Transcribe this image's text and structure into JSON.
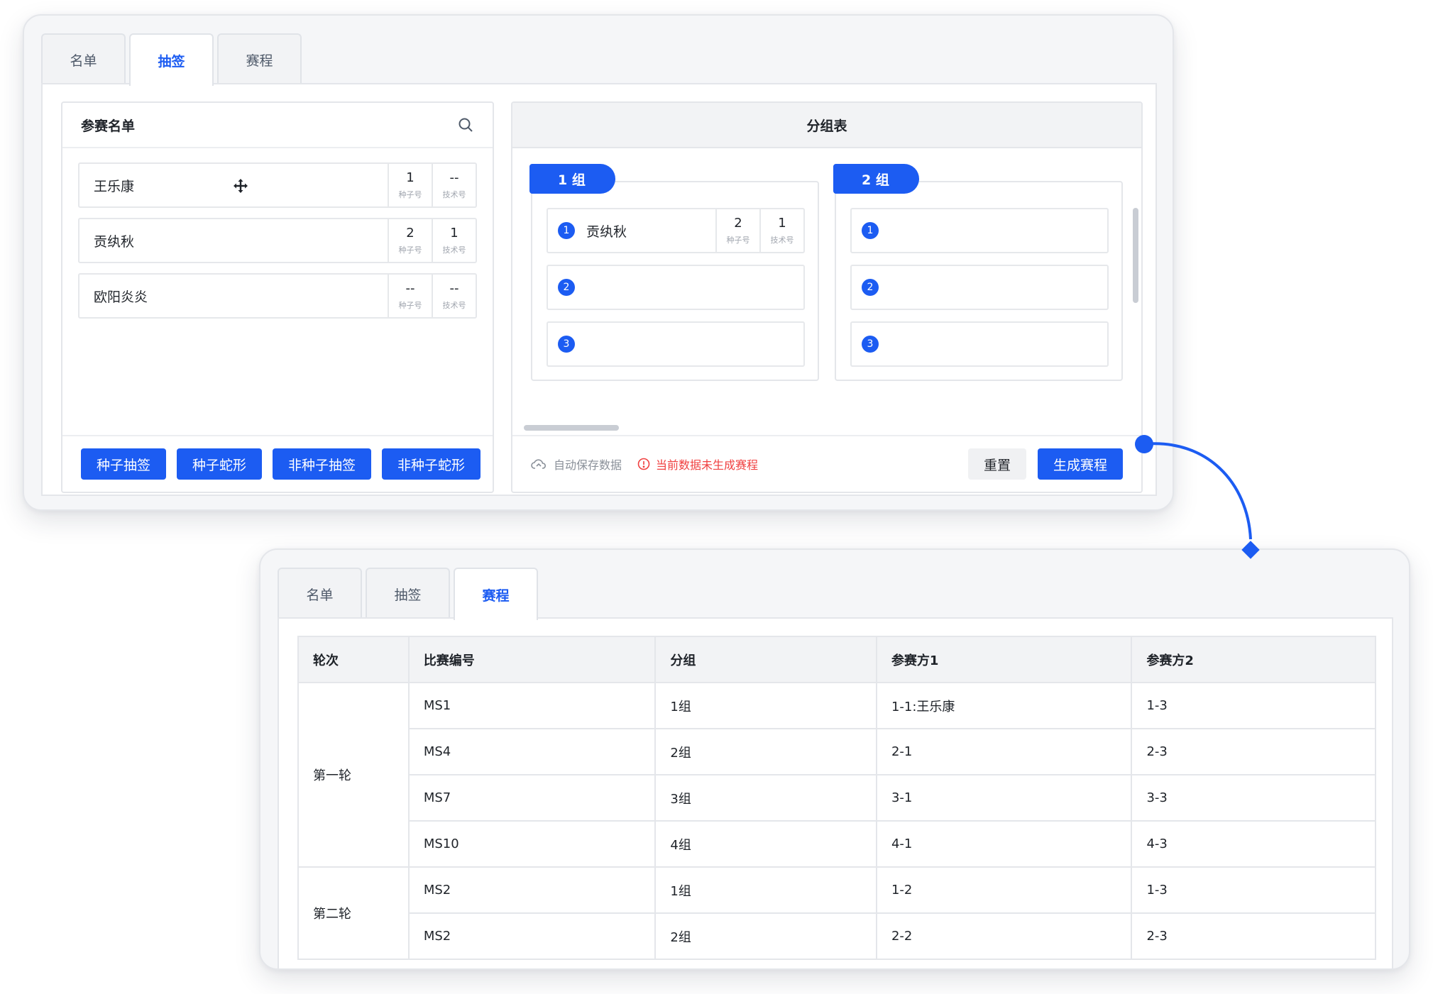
{
  "tabs": [
    "名单",
    "抽签",
    "赛程"
  ],
  "roster": {
    "title": "参赛名单",
    "seed_label": "种子号",
    "tech_label": "技术号",
    "players": [
      {
        "name": "王乐康",
        "seed": "1",
        "tech": "--"
      },
      {
        "name": "贡纨秋",
        "seed": "2",
        "tech": "1"
      },
      {
        "name": "欧阳炎炎",
        "seed": "--",
        "tech": "--"
      }
    ],
    "buttons": [
      "种子抽签",
      "种子蛇形",
      "非种子抽签",
      "非种子蛇形"
    ]
  },
  "groups": {
    "title": "分组表",
    "list": [
      {
        "label": "1 组",
        "slots": [
          {
            "num": "1",
            "name": "贡纨秋",
            "seed": "2",
            "tech": "1"
          },
          {
            "num": "2",
            "name": ""
          },
          {
            "num": "3",
            "name": ""
          }
        ]
      },
      {
        "label": "2 组",
        "slots": [
          {
            "num": "1",
            "name": ""
          },
          {
            "num": "2",
            "name": ""
          },
          {
            "num": "3",
            "name": ""
          }
        ]
      }
    ],
    "autosave": "自动保存数据",
    "warning": "当前数据未生成赛程",
    "reset": "重置",
    "generate": "生成赛程"
  },
  "schedule": {
    "headers": [
      "轮次",
      "比赛编号",
      "分组",
      "参赛方1",
      "参赛方2"
    ],
    "rounds": [
      {
        "name": "第一轮",
        "matches": [
          [
            "MS1",
            "1组",
            "1-1:王乐康",
            "1-3"
          ],
          [
            "MS4",
            "2组",
            "2-1",
            "2-3"
          ],
          [
            "MS7",
            "3组",
            "3-1",
            "3-3"
          ],
          [
            "MS10",
            "4组",
            "4-1",
            "4-3"
          ]
        ]
      },
      {
        "name": "第二轮",
        "matches": [
          [
            "MS2",
            "1组",
            "1-2",
            "1-3"
          ],
          [
            "MS2",
            "2组",
            "2-2",
            "2-3"
          ]
        ]
      }
    ]
  },
  "colors": {
    "primary": "#1c5cf2",
    "danger": "#f04040"
  }
}
